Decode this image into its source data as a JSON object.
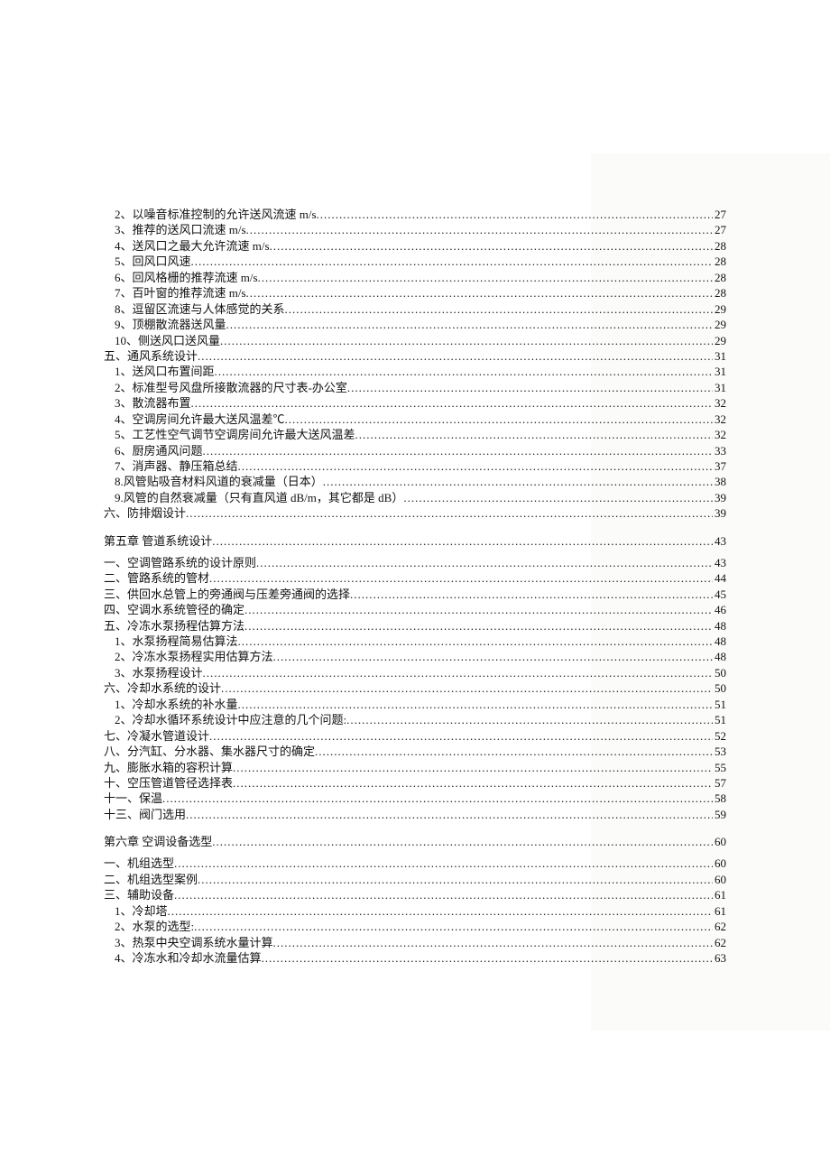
{
  "toc": {
    "entries": [
      {
        "level": "item",
        "label": "2、以噪音标准控制的允许送风流速 m/s",
        "page": "27"
      },
      {
        "level": "item",
        "label": "3、推荐的送风口流速 m/s",
        "page": "27"
      },
      {
        "level": "item",
        "label": "4、送风口之最大允许流速 m/s",
        "page": "28"
      },
      {
        "level": "item",
        "label": "5、回风口风速",
        "page": "28"
      },
      {
        "level": "item",
        "label": "6、回风格栅的推荐流速 m/s",
        "page": "28"
      },
      {
        "level": "item",
        "label": "7、百叶窗的推荐流速 m/s",
        "page": "28"
      },
      {
        "level": "item",
        "label": "8、逗留区流速与人体感觉的关系",
        "page": "29"
      },
      {
        "level": "item",
        "label": "9、顶棚散流器送风量",
        "page": "29"
      },
      {
        "level": "item",
        "label": "10、侧送风口送风量",
        "page": "29"
      },
      {
        "level": "section",
        "label": "五、通风系统设计",
        "page": "31"
      },
      {
        "level": "item",
        "label": "1、送风口布置间距",
        "page": "31"
      },
      {
        "level": "item",
        "label": "2、标准型号风盘所接散流器的尺寸表-办公室",
        "page": "31"
      },
      {
        "level": "item",
        "label": "3、散流器布置",
        "page": "32"
      },
      {
        "level": "item",
        "label": "4、空调房间允许最大送风温差℃",
        "page": "32"
      },
      {
        "level": "item",
        "label": "5、工艺性空气调节空调房间允许最大送风温差",
        "page": "32"
      },
      {
        "level": "item",
        "label": "6、厨房通风问题",
        "page": "33"
      },
      {
        "level": "item",
        "label": "7、消声器、静压箱总结",
        "page": "37"
      },
      {
        "level": "item",
        "label": "8.风管贴吸音材料风道的衰减量（日本）",
        "page": "38"
      },
      {
        "level": "item",
        "label": "9.风管的自然衰减量（只有直风道 dB/m，其它都是 dB）",
        "page": "39"
      },
      {
        "level": "section",
        "label": "六、防排烟设计",
        "page": "39"
      },
      {
        "level": "chapter",
        "label": "第五章  管道系统设计",
        "page": "43"
      },
      {
        "level": "section",
        "label": "一、空调管路系统的设计原则",
        "page": "43"
      },
      {
        "level": "section",
        "label": "二、管路系统的管材",
        "page": "44"
      },
      {
        "level": "section",
        "label": "三、供回水总管上的旁通阀与压差旁通阀的选择",
        "page": "45"
      },
      {
        "level": "section",
        "label": "四、空调水系统管径的确定",
        "page": "46"
      },
      {
        "level": "section",
        "label": "五、冷冻水泵扬程估算方法",
        "page": "48"
      },
      {
        "level": "item",
        "label": "1、水泵扬程简易估算法",
        "page": "48"
      },
      {
        "level": "item",
        "label": "2、冷冻水泵扬程实用估算方法",
        "page": "48"
      },
      {
        "level": "item",
        "label": "3、水泵扬程设计",
        "page": "50"
      },
      {
        "level": "section",
        "label": "六、冷却水系统的设计",
        "page": "50"
      },
      {
        "level": "item",
        "label": "1、冷却水系统的补水量",
        "page": "51"
      },
      {
        "level": "item",
        "label": "2、冷却水循环系统设计中应注意的几个问题:",
        "page": "51"
      },
      {
        "level": "section",
        "label": "七、冷凝水管道设计",
        "page": "52"
      },
      {
        "level": "section",
        "label": "八、分汽缸、分水器、集水器尺寸的确定",
        "page": "53"
      },
      {
        "level": "section",
        "label": "九、膨胀水箱的容积计算",
        "page": "55"
      },
      {
        "level": "section",
        "label": "十、空压管道管径选择表",
        "page": "57"
      },
      {
        "level": "section",
        "label": "十一、保温",
        "page": "58"
      },
      {
        "level": "section",
        "label": "十三、阀门选用",
        "page": "59"
      },
      {
        "level": "chapter",
        "label": "第六章  空调设备选型",
        "page": "60"
      },
      {
        "level": "section",
        "label": "一、机组选型",
        "page": "60"
      },
      {
        "level": "section",
        "label": "二、机组选型案例",
        "page": "60"
      },
      {
        "level": "section",
        "label": "三、辅助设备",
        "page": "61"
      },
      {
        "level": "item",
        "label": "1、冷却塔",
        "page": "61"
      },
      {
        "level": "item",
        "label": "2、水泵的选型:",
        "page": "62"
      },
      {
        "level": "item",
        "label": "3、热泵中央空调系统水量计算",
        "page": "62"
      },
      {
        "level": "item",
        "label": "4、冷冻水和冷却水流量估算",
        "page": "63"
      }
    ]
  }
}
